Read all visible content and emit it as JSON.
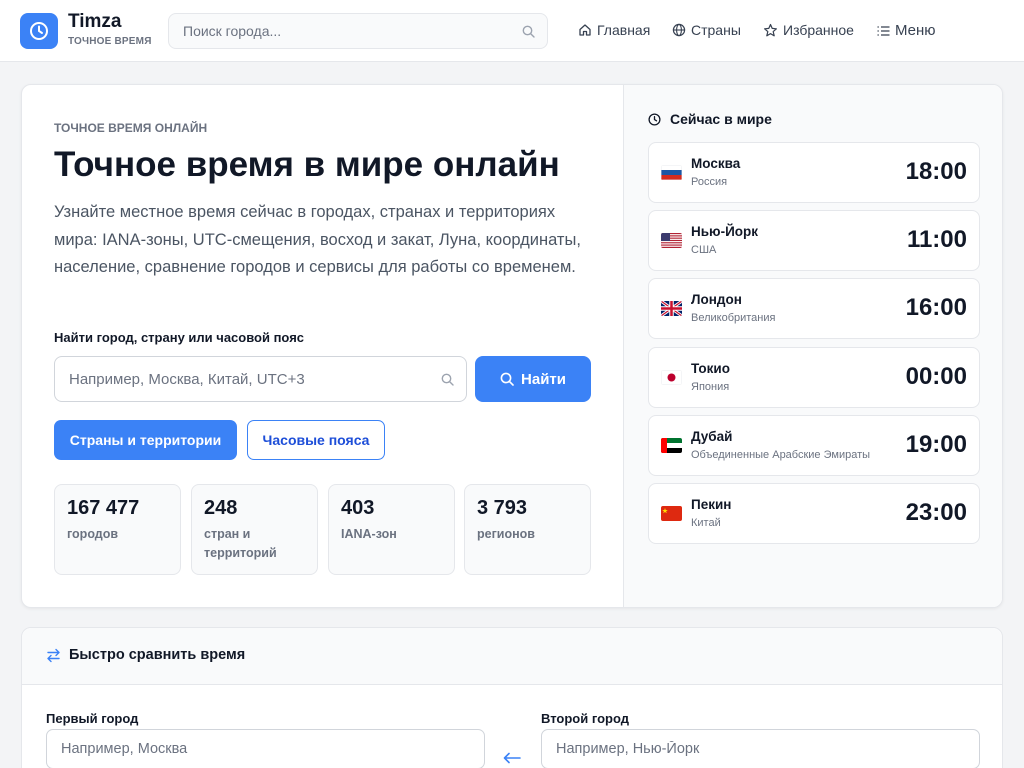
{
  "header": {
    "brand": "Timza",
    "tagline": "ТОЧНОЕ ВРЕМЯ",
    "search_placeholder": "Поиск города...",
    "nav": [
      {
        "label": "Главная",
        "icon": "home-icon"
      },
      {
        "label": "Страны",
        "icon": "globe-icon"
      },
      {
        "label": "Избранное",
        "icon": "star-icon"
      },
      {
        "label": "Меню",
        "icon": "menu-icon"
      }
    ]
  },
  "hero": {
    "eyebrow": "ТОЧНОЕ ВРЕМЯ ОНЛАЙН",
    "title": "Точное время в мире онлайн",
    "lead": "Узнайте местное время сейчас в городах, странах и территориях мира: IANA-зоны, UTC-смещения, восход и закат, Луна, координаты, население, сравнение городов и сервисы для работы со временем.",
    "find_label": "Найти город, страну или часовой пояс",
    "find_placeholder": "Например, Москва, Китай, UTC+3",
    "find_button": "Найти",
    "btn_countries": "Страны и территории",
    "btn_timezones": "Часовые пояса",
    "stats": [
      {
        "value": "167 477",
        "label": "городов"
      },
      {
        "value": "248",
        "label": "стран и территорий"
      },
      {
        "value": "403",
        "label": "IANA-зон"
      },
      {
        "value": "3 793",
        "label": "регионов"
      }
    ]
  },
  "world": {
    "title": "Сейчас в мире",
    "cities": [
      {
        "name": "Москва",
        "country": "Россия",
        "time": "18:00",
        "flag": "ru"
      },
      {
        "name": "Нью-Йорк",
        "country": "США",
        "time": "11:00",
        "flag": "us"
      },
      {
        "name": "Лондон",
        "country": "Великобритания",
        "time": "16:00",
        "flag": "gb"
      },
      {
        "name": "Токио",
        "country": "Япония",
        "time": "00:00",
        "flag": "jp"
      },
      {
        "name": "Дубай",
        "country": "Объединенные Арабские Эмираты",
        "time": "19:00",
        "flag": "ae"
      },
      {
        "name": "Пекин",
        "country": "Китай",
        "time": "23:00",
        "flag": "cn"
      }
    ]
  },
  "compare": {
    "title": "Быстро сравнить время",
    "first_label": "Первый город",
    "first_placeholder": "Например, Москва",
    "second_label": "Второй город",
    "second_placeholder": "Например, Нью-Йорк"
  },
  "colors": {
    "accent": "#3b82f6",
    "text": "#111827",
    "muted": "#6b7280",
    "border": "#e5e7eb"
  }
}
